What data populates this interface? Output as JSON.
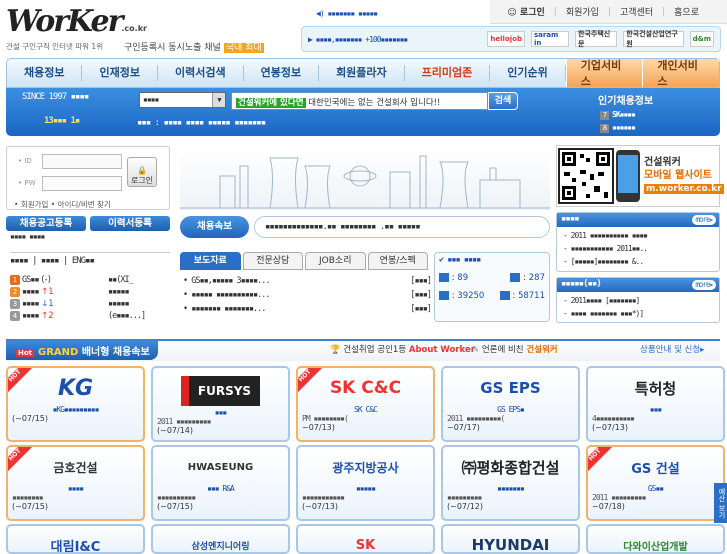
{
  "logo": {
    "main": "WorKer",
    "domain": ".co.kr",
    "tagline": "건설 구인구직 인터넷 파워 1위"
  },
  "slogan": {
    "text": "구인등록시 동시노출 채널",
    "badge": "국내 최대"
  },
  "ticker": "▪▪▪▪▪▪▪ ▪▪▪▪▪",
  "toplinks": {
    "login": "로그인",
    "join": "회원가입",
    "support": "고객센터",
    "home": "홈으로"
  },
  "partners": {
    "text": "▶ ▪▪▪▪,▪▪▪▪▪▪▪ +100▪▪▪▪▪▪▪",
    "logos": [
      "hellojob",
      "saram in",
      "한국주택신문",
      "한국건설산업연구원",
      "d&m"
    ]
  },
  "nav": {
    "items": [
      "채용정보",
      "인재정보",
      "이력서검색",
      "연봉정보",
      "회원플라자",
      "프리미엄존",
      "인기순위"
    ],
    "services": [
      "기업서비스",
      "개인서비스"
    ]
  },
  "search": {
    "since": "SINCE 1997 ▪▪▪▪",
    "since_sub": "13▪▪▪ 1▪",
    "select": "▪▪▪▪",
    "highlight": "건설워커에 있다면",
    "placeholder": "대한민국에는 없는 건설회사 입니다!!",
    "button": "검색",
    "hot": "▪▪▪ : ▪▪▪▪ ▪▪▪▪ ▪▪▪▪▪ ▪▪▪▪▪▪▪"
  },
  "rank": {
    "title": "인기채용정보",
    "items": [
      {
        "n": "7",
        "t": "SK▪▪▪▪"
      },
      {
        "n": "8",
        "t": "▪▪▪▪▪▪"
      }
    ]
  },
  "login": {
    "id_label": "• ID",
    "pw_label": "• PW",
    "button": "로그인",
    "links": "• 회원가입  • 아이디/비번 찾기"
  },
  "buttons": {
    "post": "채용공고등록",
    "resume": "이력서등록"
  },
  "left_misc": {
    "line1": "▪▪▪▪ ▪▪▪▪",
    "lang": "▪▪▪▪  |  ▪▪▪▪  |  ENG▪▪"
  },
  "ranking": [
    {
      "n": "1",
      "name": "GS▪▪",
      "chg": "(-)",
      "cls": "",
      "right": "▪▪(XI_"
    },
    {
      "n": "2",
      "name": "▪▪▪▪",
      "chg": "↑1",
      "cls": "up",
      "right": "▪▪▪▪▪"
    },
    {
      "n": "3",
      "name": "▪▪▪▪",
      "chg": "↓1",
      "cls": "dn",
      "right": "▪▪▪▪▪"
    },
    {
      "n": "4",
      "name": "▪▪▪▪",
      "chg": "↑2",
      "cls": "up",
      "right": "(e▪▪▪...]"
    }
  ],
  "breaking": {
    "label": "채용속보",
    "text": "▪▪▪▪▪▪▪▪▪▪▪▪▪.▪▪ ▪▪▪▪▪▪▪▪ .▪▪ ▪▪▪▪▪"
  },
  "tabs": [
    "보도자료",
    "전문상담",
    "JOB소리",
    "연봉/스펙"
  ],
  "news": [
    {
      "t": "• GS▪▪,▪▪▪▪▪ 3▪▪▪▪...",
      "d": "[▪▪▪]"
    },
    {
      "t": "• ▪▪▪▪▪ ▪▪▪▪▪▪▪▪▪▪...",
      "d": "[▪▪▪]"
    },
    {
      "t": "• ▪▪▪▪▪▪▪ ▪▪▪▪▪▪▪...",
      "d": "[▪▪▪]"
    }
  ],
  "stats": {
    "title": "▪▪▪ ▪▪▪▪",
    "rows": [
      {
        "a": "89",
        "b": "287"
      },
      {
        "a": "39250",
        "b": "58711"
      }
    ]
  },
  "mobile": {
    "l1": "건설워커",
    "l2": "모바일 웹사이트",
    "url": "m.worker.co.kr"
  },
  "rbox1": {
    "title": "▪▪▪▪",
    "more": "more▸",
    "items": [
      "- 2011 ▪▪▪▪▪▪▪▪▪▪ ▪▪▪▪",
      "- ▪▪▪▪▪▪▪▪▪▪▪ 2011▪▪..",
      "- [▪▪▪▪▪]▪▪▪▪▪▪▪▪ &.."
    ]
  },
  "rbox2": {
    "title": "▪▪▪▪▪(▪▪)",
    "more": "more▸",
    "items": [
      "- 2011▪▪▪▪ [▪▪▪▪▪▪▪]",
      "- ▪▪▪▪ ▪▪▪▪▪▪▪ ▪▪▪*)]"
    ]
  },
  "grand": {
    "title_a": "GRAND",
    "title_b": " 배너형 채용속보",
    "mid": "건설취업 공인1등",
    "mid_b": "About Worker",
    "mid2": "언론에 비친",
    "mid2_b": "건설워커",
    "right": "상품안내 및 신청▸"
  },
  "cards": [
    {
      "logo": "KG",
      "color": "#1a4fb0",
      "t1": "▪KG▪▪▪▪▪▪▪▪▪",
      "t2": "",
      "t3": "(~07/15)",
      "hot": true
    },
    {
      "logo": "FURSYS",
      "color": "#fff",
      "bg": "#222",
      "t1": "▪▪▪",
      "t2": "2011 ▪▪▪▪▪▪▪▪▪",
      "t3": "(~07/14)",
      "hot": false
    },
    {
      "logo": "SK C&C",
      "color": "#e33",
      "t1": "SK C&C",
      "t2": "PM ▪▪▪▪▪▪▪▪(",
      "t3": "~07/13)",
      "hot": true
    },
    {
      "logo": "GS EPS",
      "color": "#1a4fb0",
      "t1": "GS EPS▪",
      "t2": "2011 ▪▪▪▪▪▪▪▪▪(",
      "t3": "~07/17)",
      "hot": false
    },
    {
      "logo": "특허청",
      "color": "#222",
      "t1": "▪▪▪",
      "t2": "4▪▪▪▪▪▪▪▪▪▪",
      "t3": "(~07/13)",
      "hot": false
    },
    {
      "logo": "금호건설",
      "color": "#333",
      "t1": "▪▪▪▪",
      "t2": "▪▪▪▪▪▪▪▪",
      "t3": "(~07/15)",
      "hot": true
    },
    {
      "logo": "HWASEUNG",
      "color": "#333",
      "t1": "▪▪▪ R&A",
      "t2": "▪▪▪▪▪▪▪▪▪▪",
      "t3": "(~07/15)",
      "hot": false
    },
    {
      "logo": "광주지방공사",
      "color": "#1a4fb0",
      "t1": "▪▪▪▪▪",
      "t2": "▪▪▪▪▪▪▪▪▪▪▪",
      "t3": "(~07/13)",
      "hot": false
    },
    {
      "logo": "㈜평화종합건설",
      "color": "#222",
      "t1": "▪▪▪▪▪▪▪",
      "t2": "▪▪▪▪▪▪▪▪▪",
      "t3": "(~07/12)",
      "hot": false
    },
    {
      "logo": "GS 건설",
      "color": "#1a4fb0",
      "t1": "GS▪▪",
      "t2": "2011 ▪▪▪▪▪▪▪▪▪",
      "t3": "~07/18)",
      "hot": true
    }
  ],
  "row3": [
    "대림I&C",
    "삼성엔지니어링",
    "SK",
    "HYUNDAI",
    "다와이산업개발"
  ],
  "side": "예산 보기"
}
